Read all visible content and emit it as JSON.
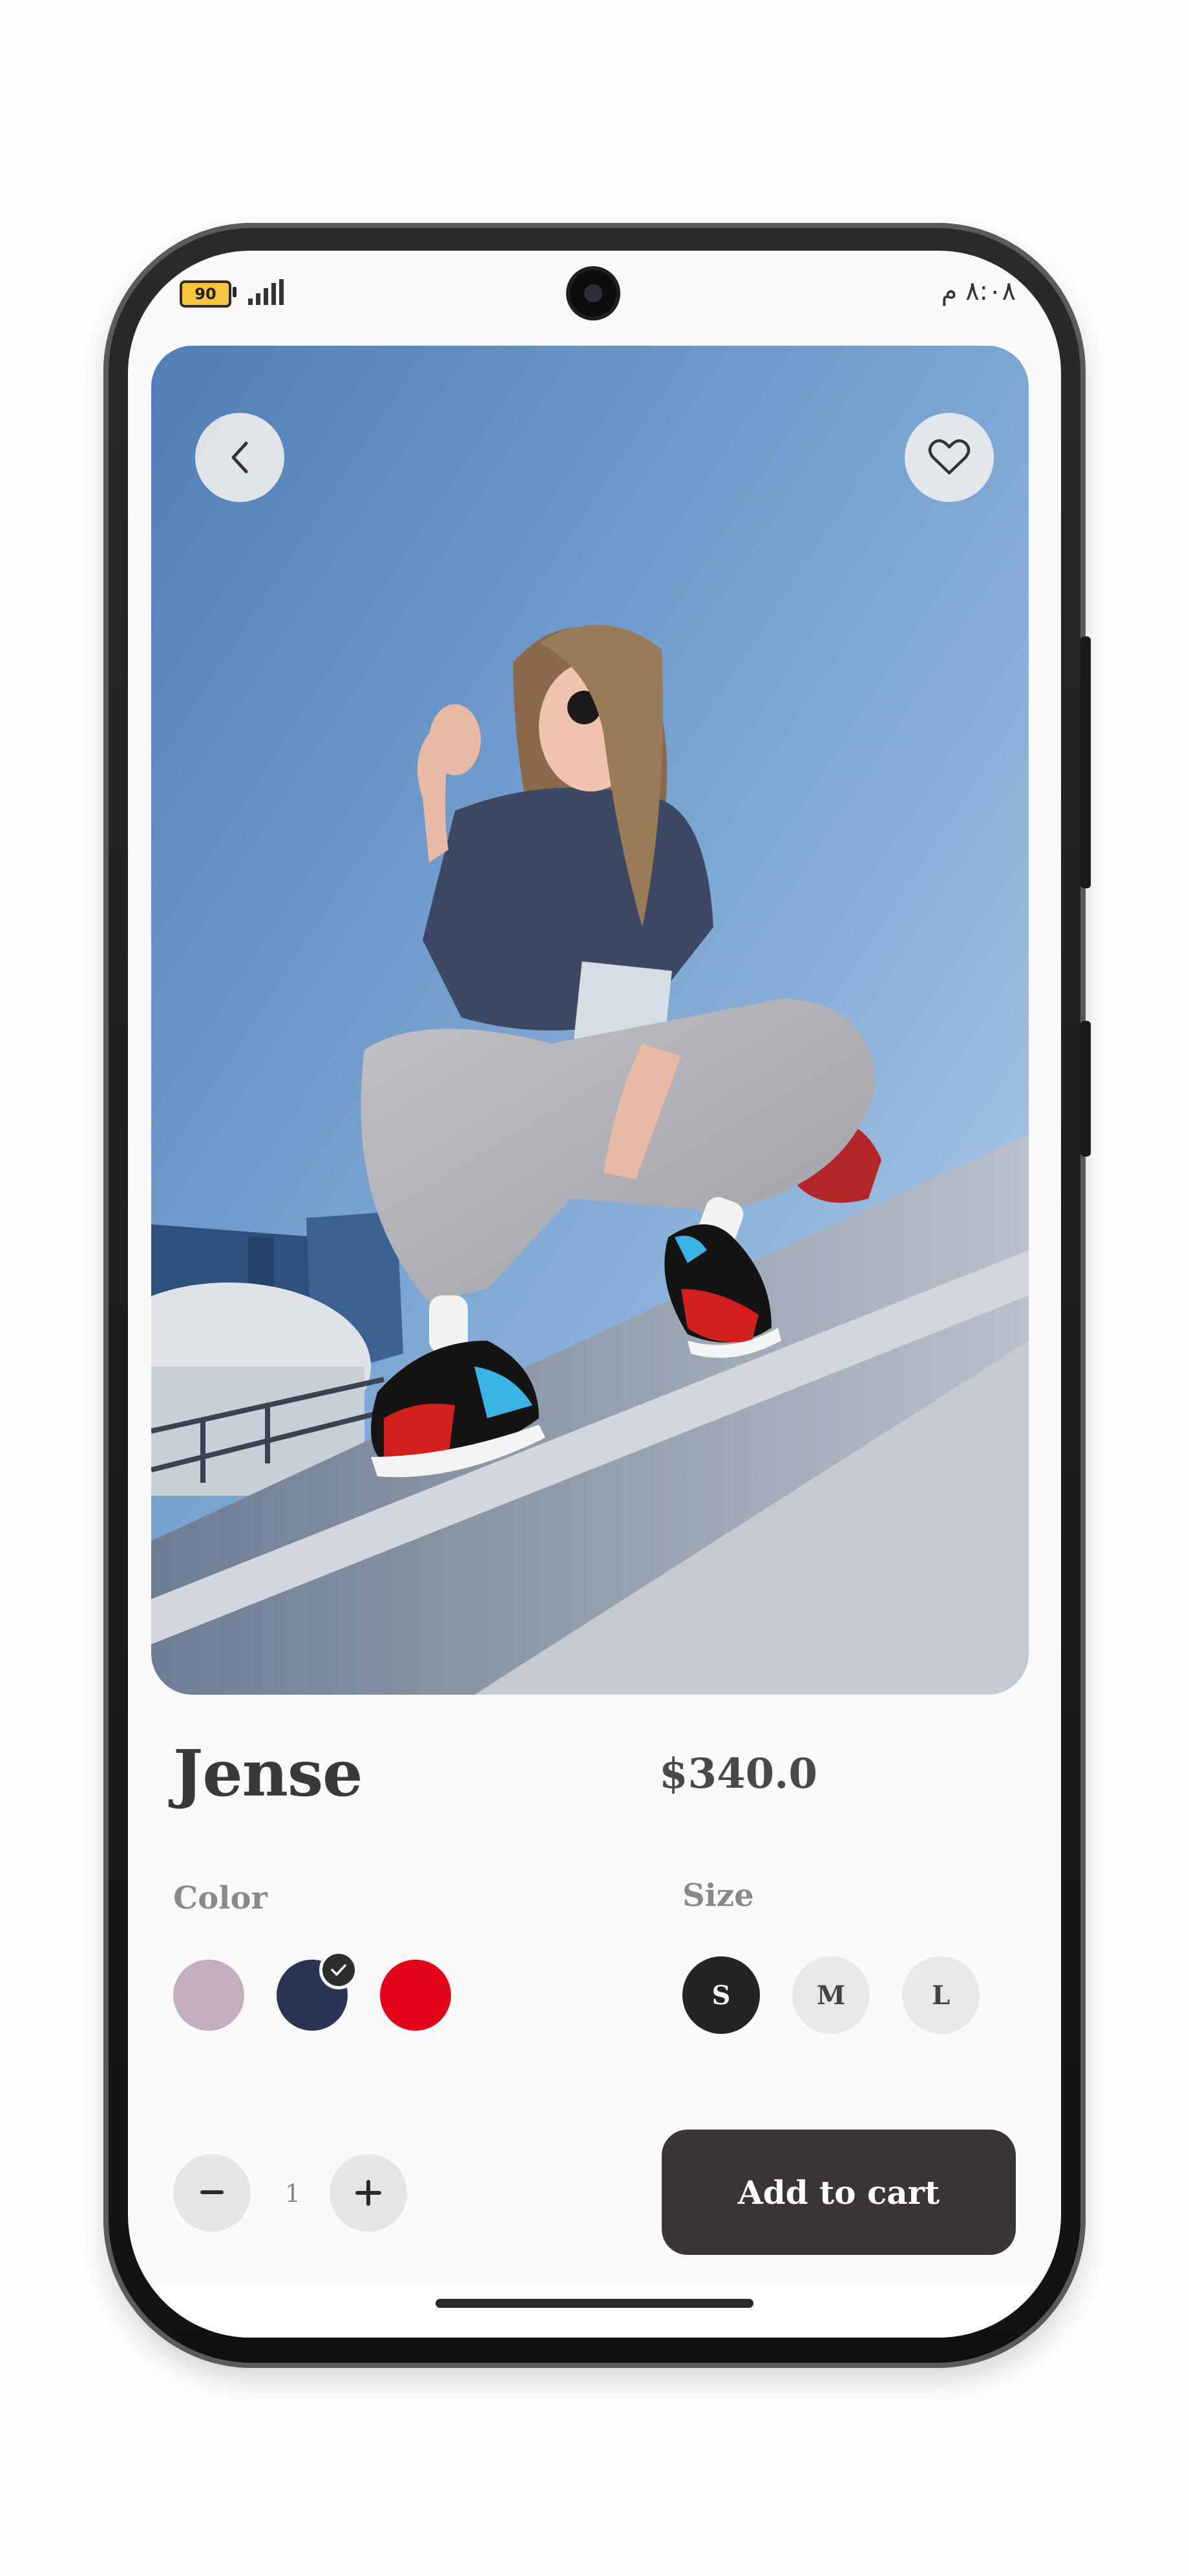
{
  "status_bar": {
    "battery": "90",
    "time": "٨:٠٨ م"
  },
  "product": {
    "name": "Jense",
    "price": "$340.0"
  },
  "color_section": {
    "label": "Color",
    "swatches": [
      {
        "name": "lilac",
        "hex": "#c2aebf",
        "selected": false
      },
      {
        "name": "navy",
        "hex": "#2a3553",
        "selected": true
      },
      {
        "name": "red",
        "hex": "#e3061a",
        "selected": false
      }
    ]
  },
  "size_section": {
    "label": "Size",
    "options": [
      {
        "label": "S",
        "selected": true
      },
      {
        "label": "M",
        "selected": false
      },
      {
        "label": "L",
        "selected": false
      }
    ]
  },
  "quantity": {
    "value": "1"
  },
  "cart": {
    "label": "Add to cart"
  },
  "icons": {
    "back": "chevron-left-icon",
    "favorite": "heart-icon",
    "decrement": "minus-icon",
    "increment": "plus-icon",
    "selected": "check-icon"
  },
  "colors": {
    "accent_dark": "#3a3636",
    "selected_size": "#252323",
    "unselected_size": "#e8e8e8"
  }
}
